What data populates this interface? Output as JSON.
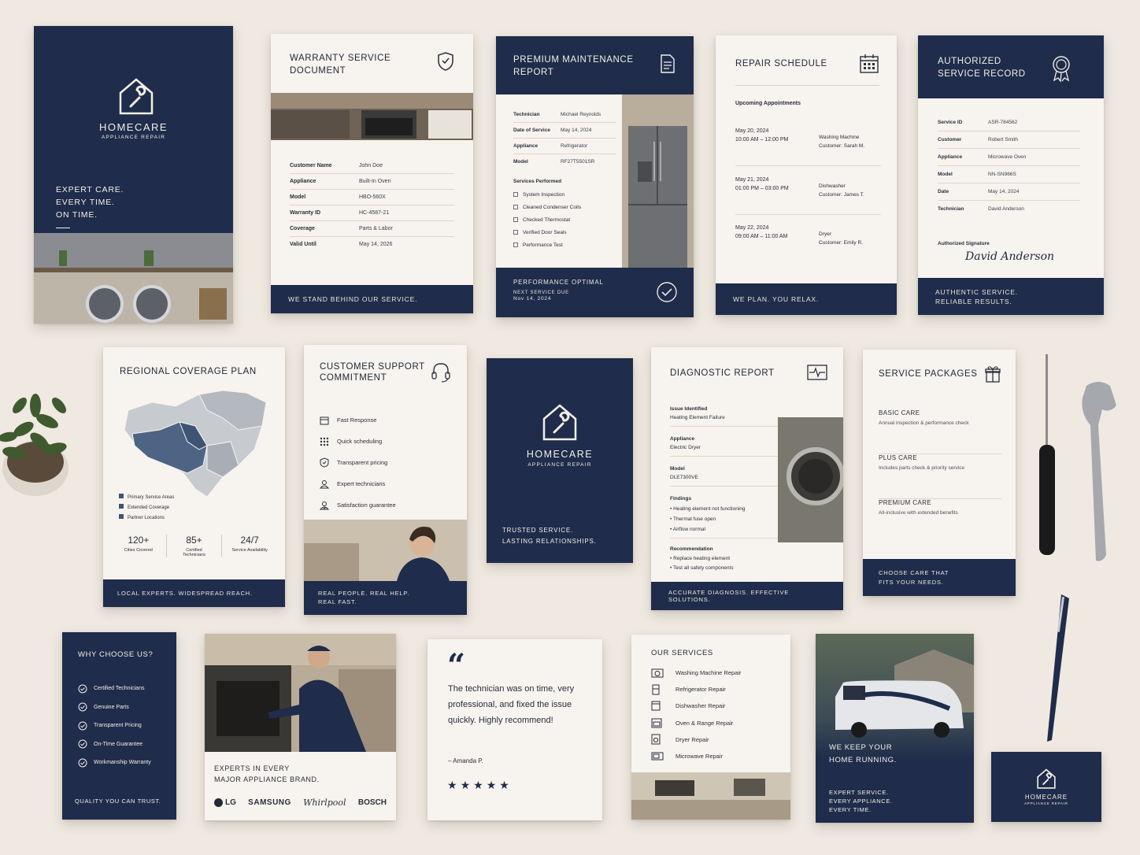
{
  "brand": {
    "name": "HOMECARE",
    "sub": "APPLIANCE REPAIR"
  },
  "cover": {
    "tagline": [
      "EXPERT CARE.",
      "EVERY TIME.",
      "ON TIME."
    ]
  },
  "warranty": {
    "title": [
      "WARRANTY SERVICE",
      "DOCUMENT"
    ],
    "rows": [
      {
        "k": "Customer Name",
        "v": "John Doe"
      },
      {
        "k": "Appliance",
        "v": "Built-In Oven"
      },
      {
        "k": "Model",
        "v": "HBO-560X"
      },
      {
        "k": "Warranty ID",
        "v": "HC-4587-21"
      },
      {
        "k": "Coverage",
        "v": "Parts & Labor"
      },
      {
        "k": "Valid Until",
        "v": "May 14, 2026"
      }
    ],
    "footer": "WE STAND BEHIND OUR SERVICE."
  },
  "premium": {
    "title": [
      "PREMIUM MAINTENANCE",
      "REPORT"
    ],
    "rows": [
      {
        "k": "Technician",
        "v": "Michael Reynolds"
      },
      {
        "k": "Date of Service",
        "v": "May 14, 2024"
      },
      {
        "k": "Appliance",
        "v": "Refrigerator"
      },
      {
        "k": "Model",
        "v": "RF27T5501SR"
      }
    ],
    "services_label": "Services Performed",
    "services": [
      "System Inspection",
      "Cleaned Condenser Coils",
      "Checked Thermostat",
      "Verified Door Seals",
      "Performance Test"
    ],
    "footer_title": "PERFORMANCE OPTIMAL",
    "next_label": "NEXT SERVICE DUE",
    "next_date": "Nov 14, 2024"
  },
  "schedule": {
    "title": "REPAIR SCHEDULE",
    "sub": "Upcoming Appointments",
    "appointments": [
      {
        "date": "May 20, 2024",
        "time": "10:00 AM – 12:00 PM",
        "appliance": "Washing Machine",
        "customer": "Customer: Sarah M."
      },
      {
        "date": "May 21, 2024",
        "time": "01:00 PM – 03:00 PM",
        "appliance": "Dishwasher",
        "customer": "Customer: James T."
      },
      {
        "date": "May 22, 2024",
        "time": "09:00 AM – 11:00 AM",
        "appliance": "Dryer",
        "customer": "Customer: Emily R."
      }
    ],
    "footer": "WE PLAN. YOU RELAX."
  },
  "authorized": {
    "title": [
      "AUTHORIZED",
      "SERVICE RECORD"
    ],
    "rows": [
      {
        "k": "Service ID",
        "v": "ASR-784562"
      },
      {
        "k": "Customer",
        "v": "Robert Smith"
      },
      {
        "k": "Appliance",
        "v": "Microwave Oven"
      },
      {
        "k": "Model",
        "v": "NN-SN966S"
      },
      {
        "k": "Date",
        "v": "May 14, 2024"
      },
      {
        "k": "Technician",
        "v": "David Anderson"
      }
    ],
    "sig_label": "Authorized Signature",
    "signature": "David Anderson",
    "footer": [
      "AUTHENTIC SERVICE.",
      "RELIABLE RESULTS."
    ]
  },
  "coverage": {
    "title": "REGIONAL COVERAGE PLAN",
    "legend": [
      "Primary Service Areas",
      "Extended Coverage",
      "Partner Locations"
    ],
    "stats": [
      {
        "value": "120+",
        "label": "Cities Covered"
      },
      {
        "value": "85+",
        "label": "Certified Technicians"
      },
      {
        "value": "24/7",
        "label": "Service Availability"
      }
    ],
    "footer": "LOCAL EXPERTS. WIDESPREAD REACH."
  },
  "support": {
    "title": [
      "CUSTOMER SUPPORT",
      "COMMITMENT"
    ],
    "items": [
      "Fast Response",
      "Quick scheduling",
      "Transparent pricing",
      "Expert technicians",
      "Satisfaction guarantee"
    ],
    "footer": [
      "REAL PEOPLE. REAL HELP.",
      "REAL FAST."
    ]
  },
  "brandcard": {
    "tagline": [
      "TRUSTED SERVICE.",
      "LASTING RELATIONSHIPS."
    ]
  },
  "diagnostic": {
    "title": "DIAGNOSTIC REPORT",
    "issue_label": "Issue Identified",
    "issue": "Heating Element Failure",
    "appliance_label": "Appliance",
    "appliance": "Electric Dryer",
    "model_label": "Model",
    "model": "DLE7300VE",
    "findings_label": "Findings",
    "findings": [
      "Heating element not functioning",
      "Thermal fuse open",
      "Airflow normal"
    ],
    "rec_label": "Recommendation",
    "recs": [
      "Replace heating element",
      "Test all safety components"
    ],
    "footer": "ACCURATE DIAGNOSIS. EFFECTIVE SOLUTIONS."
  },
  "packages": {
    "title": "SERVICE PACKAGES",
    "items": [
      {
        "name": "BASIC CARE",
        "desc": "Annual inspection & performance check"
      },
      {
        "name": "PLUS CARE",
        "desc": "Includes parts check & priority service"
      },
      {
        "name": "PREMIUM CARE",
        "desc": "All-inclusive with extended benefits"
      }
    ],
    "footer": [
      "CHOOSE CARE THAT",
      "FITS YOUR NEEDS."
    ]
  },
  "why": {
    "title": "WHY CHOOSE US?",
    "items": [
      "Certified Technicians",
      "Genuine Parts",
      "Transparent Pricing",
      "On-Time Guarantee",
      "Workmanship Warranty"
    ],
    "footer": "QUALITY YOU CAN TRUST."
  },
  "brands": {
    "caption": [
      "EXPERTS IN EVERY",
      "MAJOR APPLIANCE BRAND."
    ],
    "logos": [
      "LG",
      "SAMSUNG",
      "Whirlpool",
      "BOSCH"
    ]
  },
  "testimonial": {
    "quote": "The technician was on time, very professional, and fixed the issue quickly. Highly recommend!",
    "author": "– Amanda P.",
    "rating": 5
  },
  "services": {
    "title": "OUR SERVICES",
    "items": [
      {
        "label": "Washing Machine Repair",
        "icon": "washer-icon"
      },
      {
        "label": "Refrigerator Repair",
        "icon": "fridge-icon"
      },
      {
        "label": "Dishwasher Repair",
        "icon": "dishwasher-icon"
      },
      {
        "label": "Oven & Range Repair",
        "icon": "oven-icon"
      },
      {
        "label": "Dryer Repair",
        "icon": "dryer-icon"
      },
      {
        "label": "Microwave Repair",
        "icon": "microwave-icon"
      }
    ]
  },
  "running": {
    "headline": [
      "WE KEEP YOUR",
      "HOME RUNNING."
    ],
    "sub": [
      "EXPERT SERVICE.",
      "EVERY APPLIANCE.",
      "EVERY TIME."
    ]
  },
  "colors": {
    "navy": "#1f2c4b",
    "paper": "#f7f3ee",
    "background": "#efe9e1"
  }
}
